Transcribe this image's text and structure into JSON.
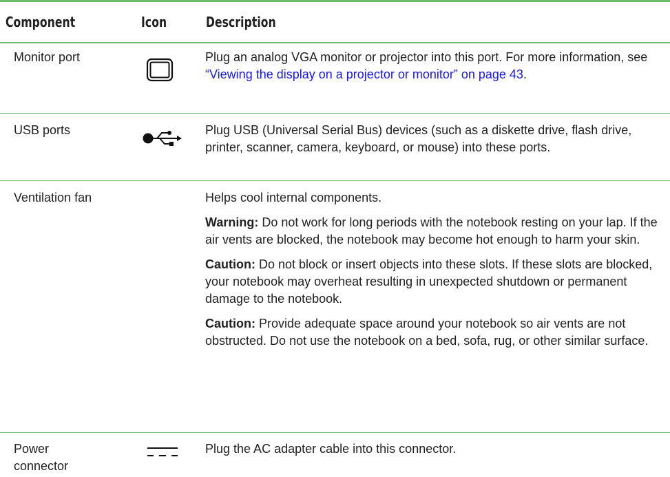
{
  "table": {
    "headers": {
      "component": "Component",
      "icon": "Icon",
      "description": "Description"
    },
    "rows": {
      "monitor": {
        "component": "Monitor port",
        "icon": "monitor-icon",
        "description_text": "Plug an analog VGA monitor or projector into this port. For more information, see ",
        "link": "“Viewing the display on a projector or monitor” on page 43",
        "description_end": "."
      },
      "usb": {
        "component": "USB ports",
        "icon": "usb-icon",
        "description": "Plug USB (Universal Serial Bus) devices (such as a diskette drive, flash drive, printer, scanner, camera, keyboard, or mouse) into these ports."
      },
      "fan": {
        "component": "Ventilation fan",
        "p1": "Helps cool internal components.",
        "warning_label": "Warning:",
        "warning_text": " Do not work for long periods with the notebook resting on your lap. If the air vents are blocked, the notebook may become hot enough to harm your skin.",
        "caution1_label": "Caution:",
        "caution1_text": " Do not block or insert objects into these slots. If these slots are blocked, your notebook may overheat resulting in unexpected shutdown or permanent damage to the notebook.",
        "caution2_label": "Caution:",
        "caution2_text": " Provide adequate space around your notebook so air vents are not obstructed. Do not use the notebook on a bed, sofa, rug, or other similar surface."
      },
      "power": {
        "component": "Power connector",
        "icon": "dc-power-icon",
        "description": "Plug the AC adapter cable into this connector."
      }
    }
  }
}
